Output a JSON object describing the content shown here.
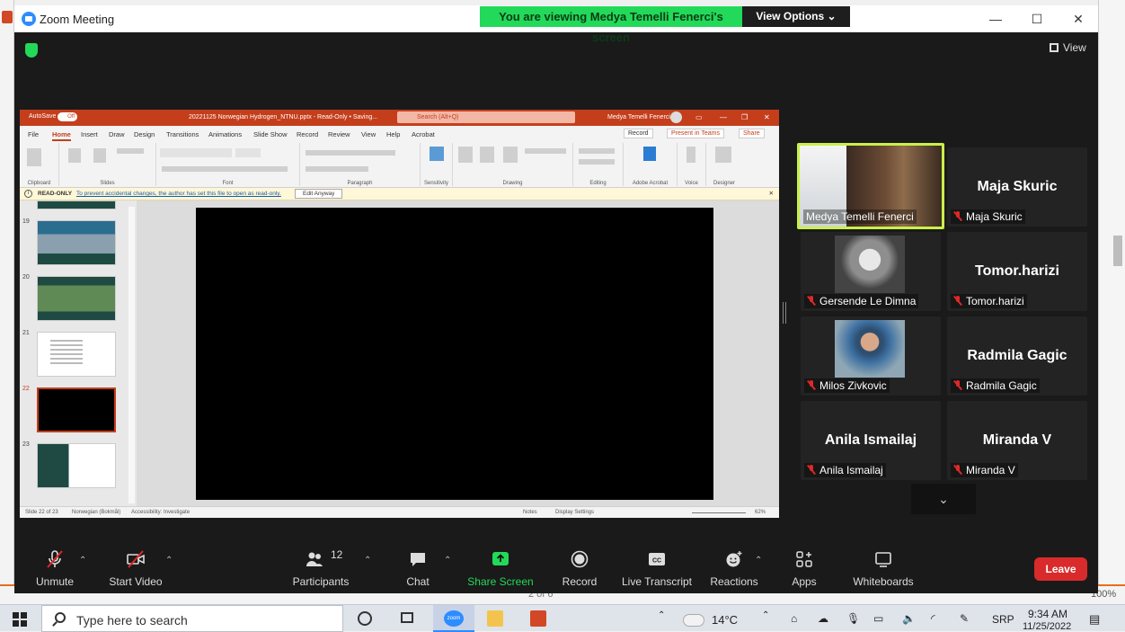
{
  "window": {
    "title": "Zoom Meeting",
    "viewing_banner": "You are viewing Medya Temelli Fenerci's screen",
    "view_options": "View Options",
    "view_label": "View"
  },
  "colors": {
    "zoom_green": "#23d959",
    "active_speaker": "#c9f04a",
    "leave_red": "#d92b2b",
    "ppt_red": "#c43e1c",
    "muted_red": "#e02828"
  },
  "ppt": {
    "autosave": "AutoSave",
    "autosave_state": "Off",
    "filename": "20221125 Norwegian Hydrogen_NTNU.pptx - Read-Only • Saving...",
    "search": "Search (Alt+Q)",
    "user": "Medya Temelli Fenerci",
    "tabs": [
      "File",
      "Home",
      "Insert",
      "Draw",
      "Design",
      "Transitions",
      "Animations",
      "Slide Show",
      "Record",
      "Review",
      "View",
      "Help",
      "Acrobat"
    ],
    "record_btn": "Record",
    "present_btn": "Present in Teams",
    "share_btn": "Share",
    "groups": [
      "Clipboard",
      "Slides",
      "Font",
      "Paragraph",
      "Sensitivity",
      "Drawing",
      "Editing",
      "Adobe Acrobat",
      "Voice",
      "Designer"
    ],
    "readonly_label": "READ-ONLY",
    "readonly_msg": "To prevent accidental changes, the author has set this file to open as read-only.",
    "edit_anyway": "Edit Anyway",
    "slide_numbers": [
      "19",
      "20",
      "21",
      "22",
      "23"
    ],
    "status_slide": "Slide 22 of 23",
    "status_lang": "Norwegian (Bokmål)",
    "status_access": "Accessibility: Investigate",
    "status_notes": "Notes",
    "status_display": "Display Settings",
    "zoom_pct": "62%"
  },
  "participants": [
    {
      "name": "Medya Temelli Fenerci",
      "video": true,
      "active": true,
      "muted": false
    },
    {
      "name": "Maja Skuric",
      "video": false,
      "muted": true
    },
    {
      "name": "Gersende Le Dimna",
      "video": true,
      "muted": true
    },
    {
      "name": "Tomor.harizi",
      "video": false,
      "muted": true
    },
    {
      "name": "Milos Zivkovic",
      "video": true,
      "muted": true
    },
    {
      "name": "Radmila Gagic",
      "video": false,
      "muted": true
    },
    {
      "name": "Anila Ismailaj",
      "video": false,
      "muted": true
    },
    {
      "name": "Miranda V",
      "video": false,
      "muted": true
    }
  ],
  "toolbar": {
    "unmute": "Unmute",
    "start_video": "Start Video",
    "participants": "Participants",
    "participant_count": "12",
    "chat": "Chat",
    "share_screen": "Share Screen",
    "record": "Record",
    "live_transcript": "Live Transcript",
    "reactions": "Reactions",
    "apps": "Apps",
    "whiteboards": "Whiteboards",
    "leave": "Leave"
  },
  "taskbar": {
    "search_placeholder": "Type here to search",
    "weather": "14°C",
    "language": "SRP",
    "time": "9:34 AM",
    "date": "11/25/2022",
    "zoom_label": "zoom"
  },
  "background": {
    "page_indicator": "2 of 6",
    "zoom_pct": "100%"
  }
}
